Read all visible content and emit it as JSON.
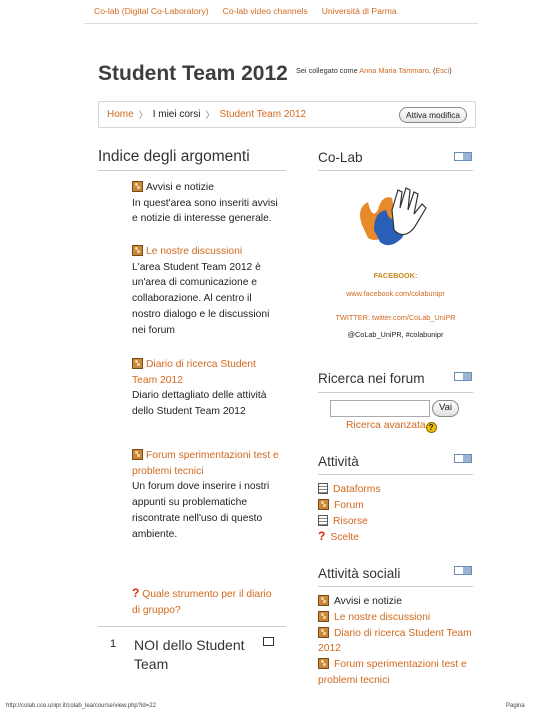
{
  "topnav": {
    "link1": "Co-lab (Digital Co-Laboratory)",
    "link2": "Co-lab video channels",
    "link3": "Università di Parma"
  },
  "header": {
    "title": "Student Team 2012",
    "login_prefix": "Sei collegato come",
    "user": "Anna Maria Tammaro",
    "logout": "Esci"
  },
  "breadcrumb": {
    "home": "Home",
    "mycourses": "I miei corsi",
    "current": "Student Team 2012",
    "edit_button": "Attiva modifica"
  },
  "main": {
    "heading": "Indice degli argomenti",
    "items": [
      {
        "title": "Avvisi e notizie",
        "desc": "In quest'area sono inseriti avvisi e notizie di interesse generale."
      },
      {
        "title": "Le nostre discussioni",
        "desc": "L'area Student Team 2012 è un'area di comunicazione e collaborazione. Al centro il nostro dialogo e le discussioni nei forum"
      },
      {
        "title": "Diario di ricerca Student Team 2012",
        "desc": "Diario dettagliato delle attività dello Student Team 2012"
      },
      {
        "title": "Forum sperimentazioni test e problemi tecnici",
        "desc": "Un forum dove inserire i nostri appunti su problematiche riscontrate nell'uso di questo ambiente."
      },
      {
        "title": "Quale strumento per il diario di gruppo?"
      }
    ],
    "section1": {
      "number": "1",
      "title": "NOI dello Student Team"
    }
  },
  "colab_block": {
    "heading": "Co-Lab",
    "facebook_label": "FACEBOOK:",
    "facebook_url": "www.facebook.com/colabunipr",
    "twitter_label": "TWITTER: twitter.com/CoLab_UniPR",
    "twitter_handle": "@CoLab_UniPR, #colabunipr"
  },
  "search_block": {
    "heading": "Ricerca nei forum",
    "button": "Vai",
    "advanced": "Ricerca avanzata"
  },
  "activity_block": {
    "heading": "Attività",
    "items": [
      "Dataforms",
      "Forum",
      "Risorse",
      "Scelte"
    ]
  },
  "social_block": {
    "heading": "Attività sociali",
    "items": [
      "Avvisi e notizie",
      "Le nostre discussioni",
      "Diario di ricerca Student Team 2012",
      "Forum sperimentazioni test e problemi tecnici"
    ]
  },
  "footer": {
    "url": "http://colab.cce.unipr.it/colab_lea/course/view.php?id=22",
    "page": "Pagina"
  },
  "colors": {
    "link": "#d2691e",
    "accent_blue": "#6b8cb4"
  }
}
